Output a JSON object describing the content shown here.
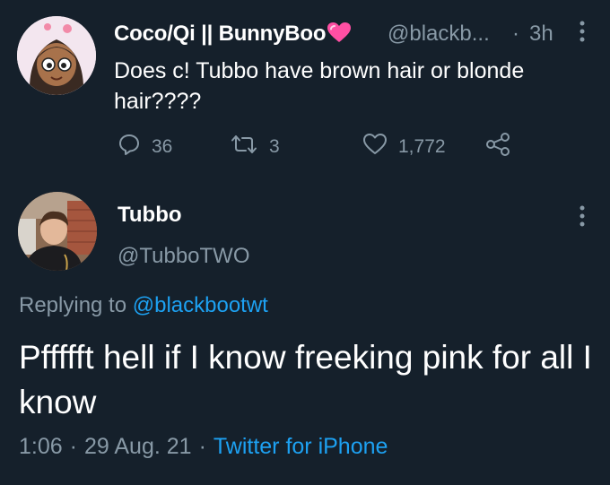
{
  "original_tweet": {
    "display_name": "Coco/Qi || BunnyBoo",
    "handle": "@blackb...",
    "separator": "·",
    "time": "3h",
    "text": "Does c! Tubbo have brown hair or blonde hair????",
    "actions": {
      "replies": "36",
      "retweets": "3",
      "likes": "1,772"
    },
    "icons": [
      "avatar",
      "heart-emoji-icon",
      "more-icon",
      "reply-icon",
      "retweet-icon",
      "like-icon",
      "share-icon"
    ]
  },
  "reply_tweet": {
    "display_name": "Tubbo",
    "handle": "@TubboTWO",
    "replying_prefix": "Replying to",
    "replying_to": "@blackbootwt",
    "text": "Pffffft hell if I know freeking pink for all I know",
    "time": "1:06",
    "date": "29 Aug. 21",
    "separator": "·",
    "source": "Twitter for iPhone"
  },
  "colors": {
    "background": "#15202b",
    "text": "#ffffff",
    "secondary": "#8899a6",
    "accent": "#1da1f2",
    "heart_emoji": "#ff4fa3"
  }
}
